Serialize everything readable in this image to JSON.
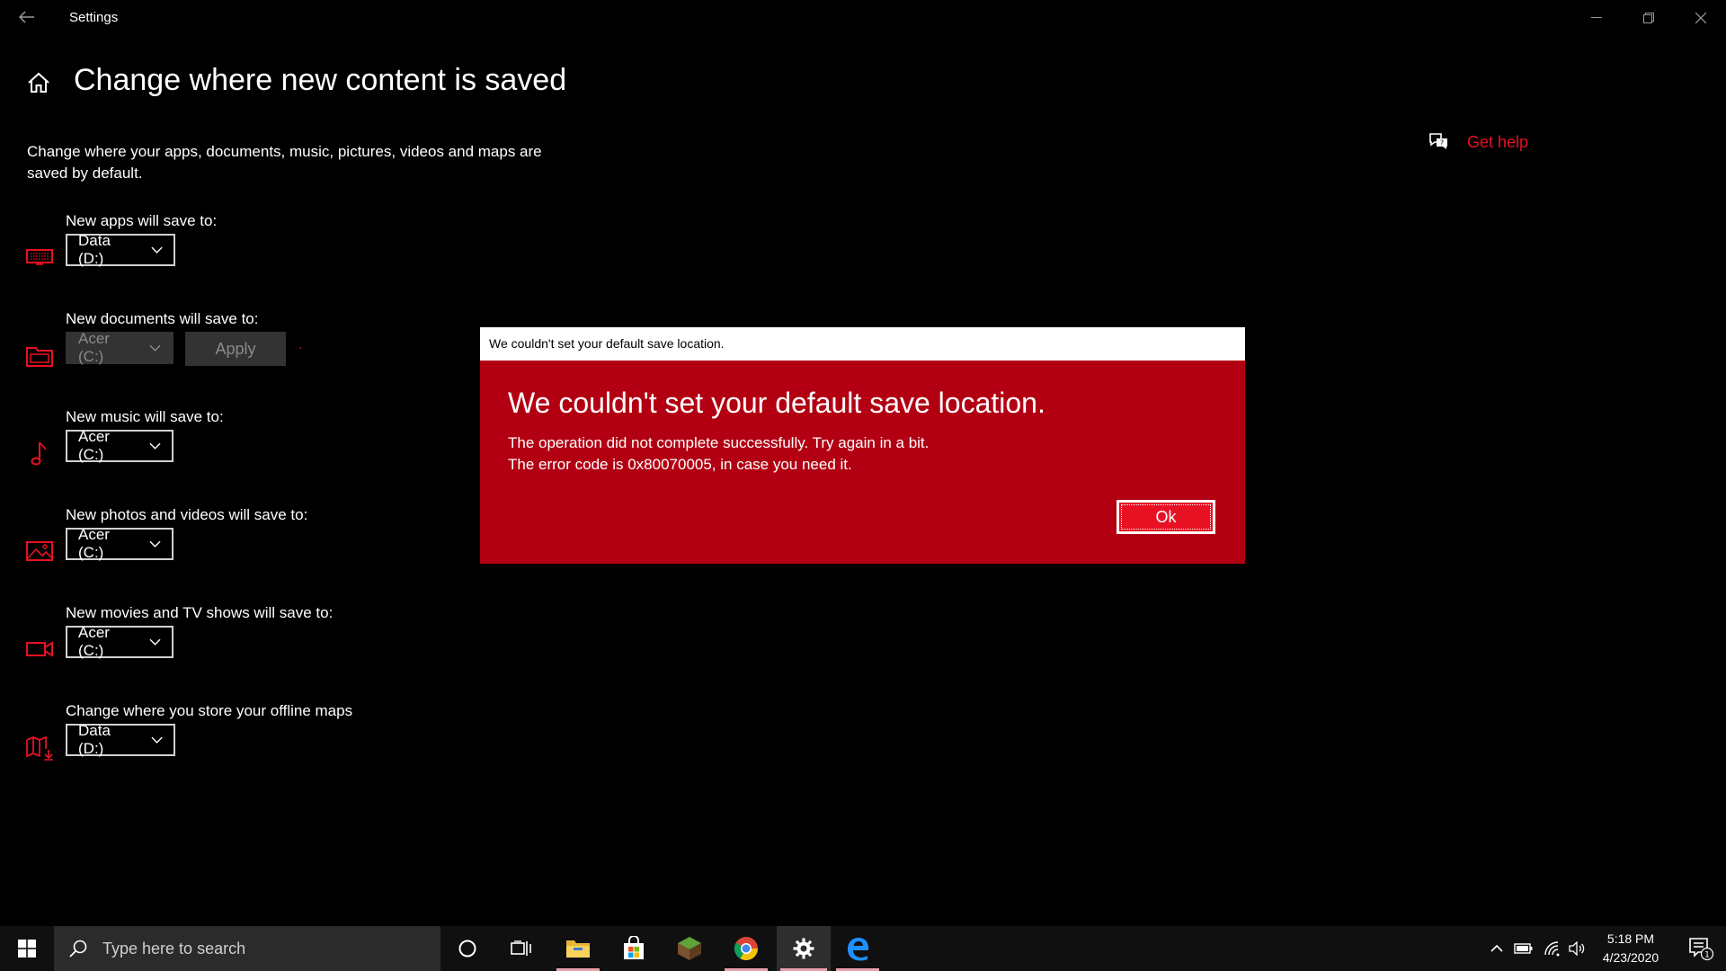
{
  "window": {
    "app_title": "Settings"
  },
  "page": {
    "title": "Change where new content is saved",
    "description": "Change where your apps, documents, music, pictures, videos and maps are saved by default.",
    "get_help": "Get help"
  },
  "settings": [
    {
      "label": "New apps will save to:",
      "value": "Data (D:)",
      "icon": "monitor-icon"
    },
    {
      "label": "New documents will save to:",
      "value": "Acer (C:)",
      "icon": "folder-icon",
      "disabled": true,
      "apply_label": "Apply"
    },
    {
      "label": "New music will save to:",
      "value": "Acer (C:)",
      "icon": "music-note-icon"
    },
    {
      "label": "New photos and videos will save to:",
      "value": "Acer (C:)",
      "icon": "photo-icon"
    },
    {
      "label": "New movies and TV shows will save to:",
      "value": "Acer (C:)",
      "icon": "video-camera-icon"
    },
    {
      "label": "Change where you store your offline maps",
      "value": "Data (D:)",
      "icon": "map-icon"
    }
  ],
  "dialog": {
    "title": "We couldn't set your default save location.",
    "heading": "We couldn't set your default save location.",
    "line1": "The operation did not complete successfully. Try again in a bit.",
    "line2": "The error code is 0x80070005, in case you need it.",
    "ok_label": "Ok"
  },
  "taskbar": {
    "search_placeholder": "Type here to search",
    "time": "5:18 PM",
    "date": "4/23/2020",
    "notification_count": "1"
  },
  "colors": {
    "accent": "#e81123",
    "dialog_bg": "#b20012"
  }
}
